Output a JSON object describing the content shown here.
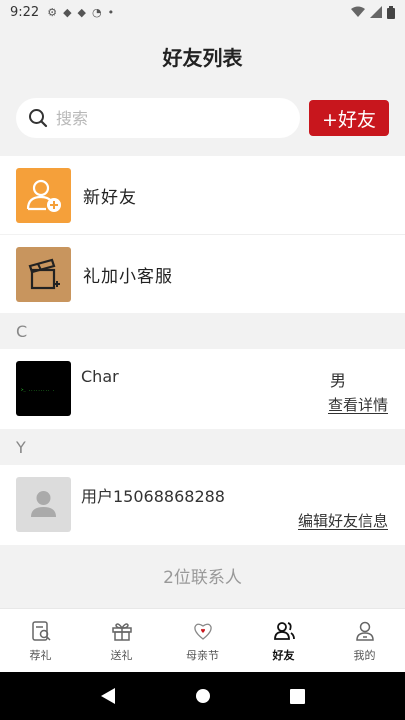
{
  "status_bar": {
    "time": "9:22"
  },
  "header": {
    "title": "好友列表"
  },
  "search": {
    "placeholder": "搜索",
    "add_label": "+好友"
  },
  "top_items": [
    {
      "label": "新好友"
    },
    {
      "label": "礼加小客服"
    }
  ],
  "sections": [
    {
      "letter": "C",
      "contact": {
        "name": "Char",
        "gender": "男",
        "action": "查看详情"
      }
    },
    {
      "letter": "Y",
      "contact": {
        "name": "用户15068868288",
        "gender": "",
        "action": "编辑好友信息"
      }
    }
  ],
  "footer": {
    "count_text": "2位联系人"
  },
  "tabs": [
    {
      "label": "荐礼",
      "icon": "recommend-gift-icon"
    },
    {
      "label": "送礼",
      "icon": "gift-box-icon"
    },
    {
      "label": "母亲节",
      "icon": "mothers-day-icon"
    },
    {
      "label": "好友",
      "icon": "friends-icon",
      "active": true
    },
    {
      "label": "我的",
      "icon": "profile-icon"
    }
  ],
  "colors": {
    "accent": "#c8161d",
    "orange": "#f5a03a",
    "brown": "#c8955e"
  }
}
